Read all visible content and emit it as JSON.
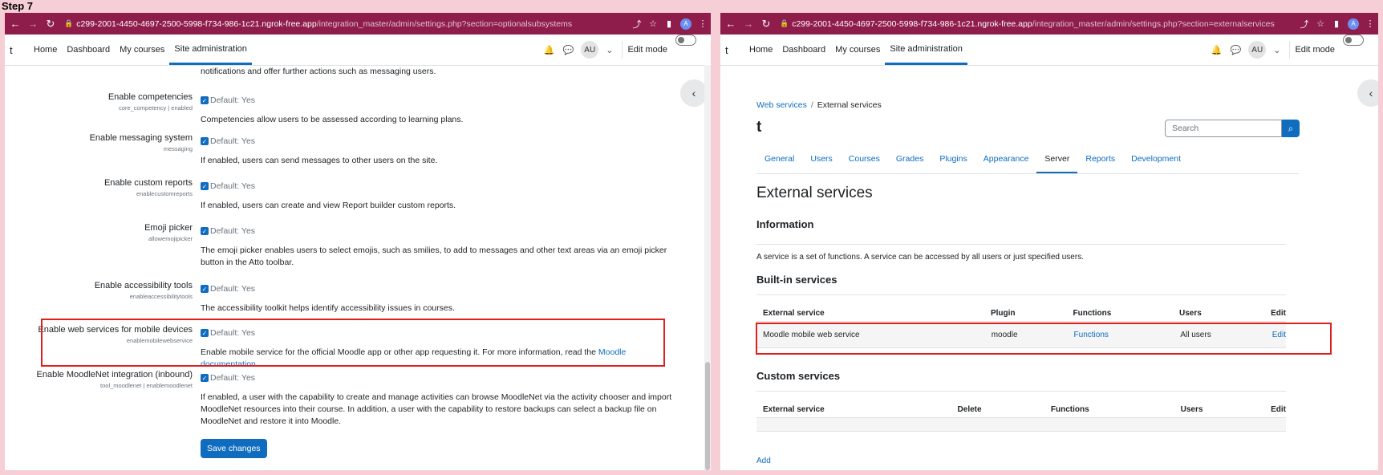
{
  "step_label": "Step 7",
  "left": {
    "url_host": "c299-2001-4450-4697-2500-5998-f734-986-1c21.ngrok-free.app",
    "url_path": "/integration_master/admin/settings.php?section=optionalsubsystems",
    "nav": {
      "brand": "t",
      "links": [
        "Home",
        "Dashboard",
        "My courses",
        "Site administration"
      ],
      "avatar": "AU",
      "edit_mode": "Edit mode"
    },
    "intro_text": "notifications and offer further actions such as messaging users.",
    "settings": [
      {
        "label": "Enable competencies",
        "key": "core_competency | enabled",
        "default": "Default: Yes",
        "desc": "Competencies allow users to be assessed according to learning plans."
      },
      {
        "label": "Enable messaging system",
        "key": "messaging",
        "default": "Default: Yes",
        "desc": "If enabled, users can send messages to other users on the site."
      },
      {
        "label": "Enable custom reports",
        "key": "enablecustomreports",
        "default": "Default: Yes",
        "desc": "If enabled, users can create and view Report builder custom reports."
      },
      {
        "label": "Emoji picker",
        "key": "allowemojipicker",
        "default": "Default: Yes",
        "desc": "The emoji picker enables users to select emojis, such as smilies, to add to messages and other text areas via an emoji picker button in the Atto toolbar."
      },
      {
        "label": "Enable accessibility tools",
        "key": "enableaccessibilitytools",
        "default": "Default: Yes",
        "desc": "The accessibility toolkit helps identify accessibility issues in courses."
      },
      {
        "label": "Enable web services for mobile devices",
        "key": "enablemobilewebservice",
        "default": "Default: Yes",
        "desc": "Enable mobile service for the official Moodle app or other app requesting it. For more information, read the",
        "link": "Moodle documentation"
      },
      {
        "label": "Enable MoodleNet integration (inbound)",
        "key": "tool_moodlenet | enablemoodlenet",
        "default": "Default: Yes",
        "desc": "If enabled, a user with the capability to create and manage activities can browse MoodleNet via the activity chooser and import MoodleNet resources into their course. In addition, a user with the capability to restore backups can select a backup file on MoodleNet and restore it into Moodle."
      }
    ],
    "save_label": "Save changes"
  },
  "right": {
    "url_host": "c299-2001-4450-4697-2500-5998-f734-986-1c21.ngrok-free.app",
    "url_path": "/integration_master/admin/settings.php?section=externalservices",
    "nav": {
      "brand": "t",
      "links": [
        "Home",
        "Dashboard",
        "My courses",
        "Site administration"
      ],
      "avatar": "AU",
      "edit_mode": "Edit mode"
    },
    "breadcrumb": [
      "Web services",
      "External services"
    ],
    "site_title": "t",
    "search_placeholder": "Search",
    "tabs": [
      "General",
      "Users",
      "Courses",
      "Grades",
      "Plugins",
      "Appearance",
      "Server",
      "Reports",
      "Development"
    ],
    "active_tab": "Server",
    "page_title": "External services",
    "info_heading": "Information",
    "info_text": "A service is a set of functions. A service can be accessed by all users or just specified users.",
    "builtin_heading": "Built-in services",
    "builtin_headers": [
      "External service",
      "Plugin",
      "Functions",
      "Users",
      "Edit"
    ],
    "builtin_row": {
      "service": "Moodle mobile web service",
      "plugin": "moodle",
      "functions": "Functions",
      "users": "All users",
      "edit": "Edit"
    },
    "custom_heading": "Custom services",
    "custom_headers": [
      "External service",
      "Delete",
      "Functions",
      "Users",
      "Edit"
    ],
    "add_label": "Add"
  },
  "colors": {
    "chrome": "#8f1d4b",
    "accent": "#0f6cbf",
    "highlight": "#e0201f",
    "background": "#f6cfd6"
  }
}
